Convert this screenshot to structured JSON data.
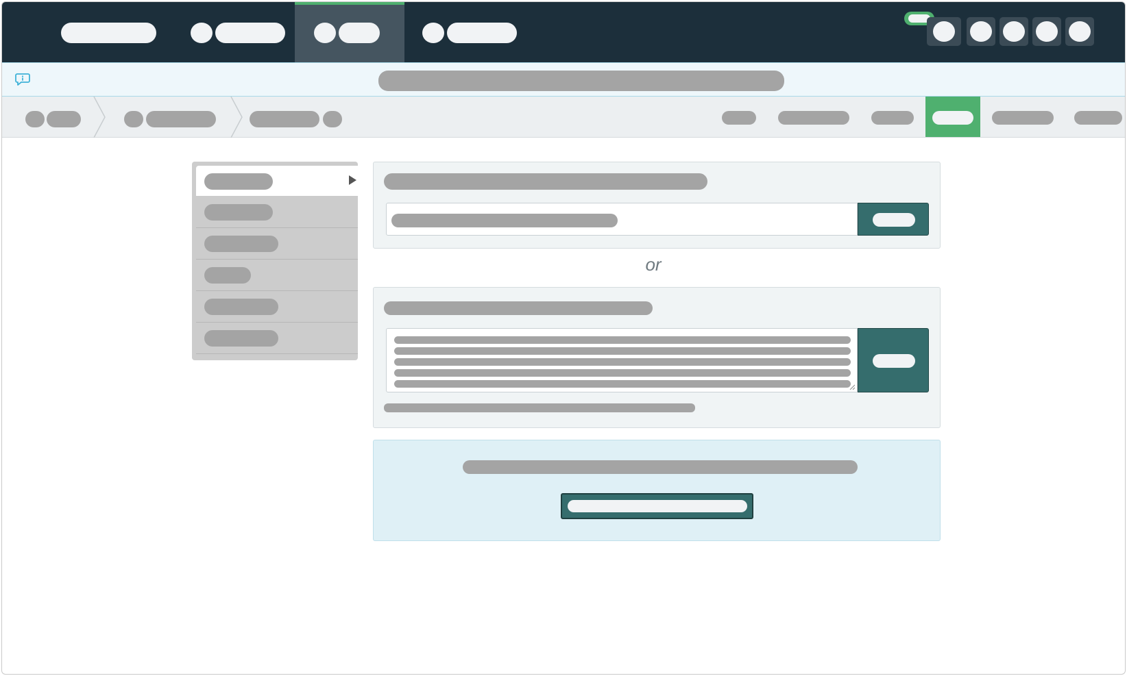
{
  "search": {
    "divider_label": "or"
  },
  "icons": {
    "announcement": "chat-info-icon",
    "menu_caret": "caret-right-icon",
    "textarea_resize": "resize-handle-icon"
  },
  "colors": {
    "nav_background": "#1c2f3b",
    "nav_active": "#455560",
    "accent_green": "#4fb06f",
    "button_teal": "#356d6d",
    "announce_bg": "#eef7fb",
    "info_bg": "#dff0f6"
  }
}
